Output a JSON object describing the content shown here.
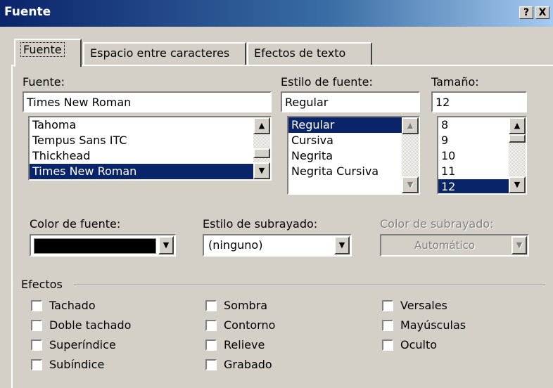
{
  "window": {
    "title": "Fuente",
    "help_button": "?",
    "close_button": "X"
  },
  "tabs": [
    {
      "label": "Fuente",
      "active": true
    },
    {
      "label": "Espacio entre caracteres",
      "active": false
    },
    {
      "label": "Efectos de texto",
      "active": false
    }
  ],
  "font": {
    "label": "Fuente:",
    "value": "Times New Roman",
    "items": [
      "Tahoma",
      "Tempus Sans ITC",
      "Thickhead",
      "Times New Roman"
    ],
    "selected_index": 3
  },
  "font_style": {
    "label": "Estilo de fuente:",
    "value": "Regular",
    "items": [
      "Regular",
      "Cursiva",
      "Negrita",
      "Negrita Cursiva"
    ],
    "selected_index": 0
  },
  "size": {
    "label": "Tamaño:",
    "value": "12",
    "items": [
      "8",
      "9",
      "10",
      "11",
      "12"
    ],
    "selected_index": 4
  },
  "font_color": {
    "label": "Color de fuente:",
    "value_color": "#000000"
  },
  "underline_style": {
    "label": "Estilo de subrayado:",
    "value": "(ninguno)"
  },
  "underline_color": {
    "label": "Color de subrayado:",
    "value": "Automático",
    "disabled": true
  },
  "effects": {
    "label": "Efectos",
    "col1": [
      "Tachado",
      "Doble tachado",
      "Superíndice",
      "Subíndice"
    ],
    "col2": [
      "Sombra",
      "Contorno",
      "Relieve",
      "Grabado"
    ],
    "col3": [
      "Versales",
      "Mayúsculas",
      "Oculto"
    ]
  },
  "colors": {
    "title_bar_start": "#0a246a",
    "title_bar_end": "#a6caf0",
    "selection": "#0a246a",
    "face": "#d4d0c8"
  }
}
